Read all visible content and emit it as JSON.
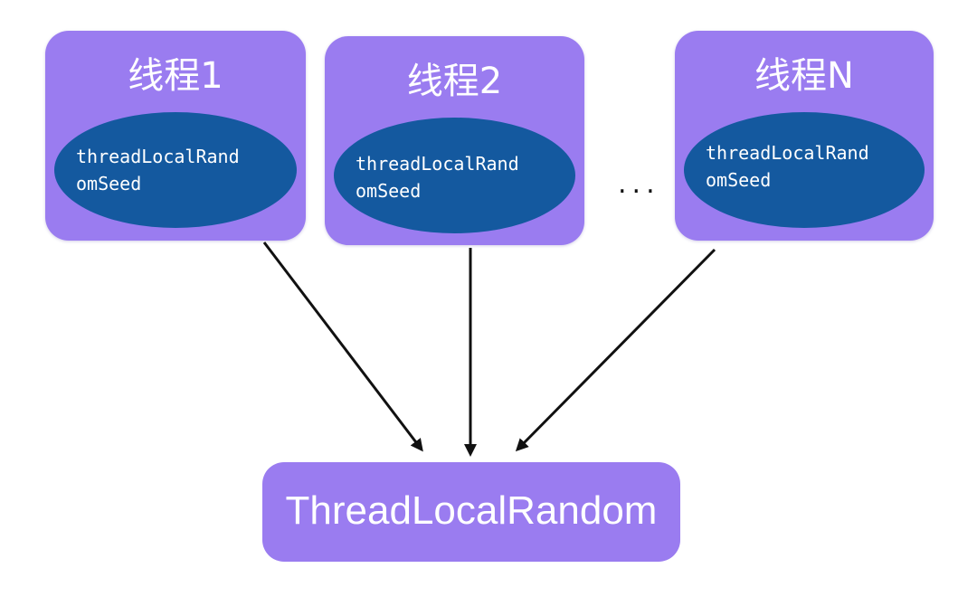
{
  "threads": [
    {
      "title": "线程1",
      "seed_line1": "threadLocalRand",
      "seed_line2": "omSeed"
    },
    {
      "title": "线程2",
      "seed_line1": "threadLocalRand",
      "seed_line2": "omSeed"
    },
    {
      "title": "线程N",
      "seed_line1": "threadLocalRand",
      "seed_line2": "omSeed"
    }
  ],
  "ellipsis": "...",
  "target": {
    "label": "ThreadLocalRandom"
  },
  "colors": {
    "box": "#9a7cf0",
    "ellipse": "#14599f",
    "text": "#ffffff",
    "arrow": "#111111"
  }
}
